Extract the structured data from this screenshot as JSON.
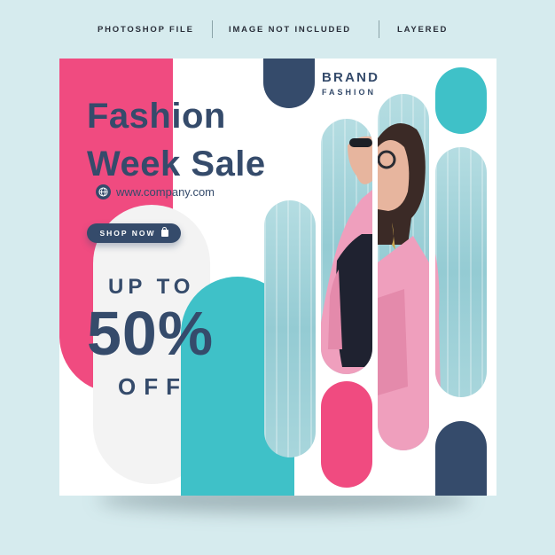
{
  "topbar": {
    "items": [
      "PHOTOSHOP FILE",
      "IMAGE NOT INCLUDED",
      "LAYERED"
    ]
  },
  "brand": {
    "name": "BRAND",
    "tagline": "FASHION"
  },
  "headline": {
    "line1": "Fashion",
    "line2": "Week Sale"
  },
  "website": {
    "icon": "globe-icon",
    "url": "www.company.com"
  },
  "cta": {
    "label": "SHOP NOW",
    "icon": "shopping-bag-icon"
  },
  "offer": {
    "prefix": "UP TO",
    "amount": "50%",
    "suffix": "OFF"
  },
  "colors": {
    "background": "#d6ebee",
    "pink": "#f04b80",
    "teal": "#3fc1c8",
    "navy": "#354b6b",
    "white": "#ffffff"
  }
}
